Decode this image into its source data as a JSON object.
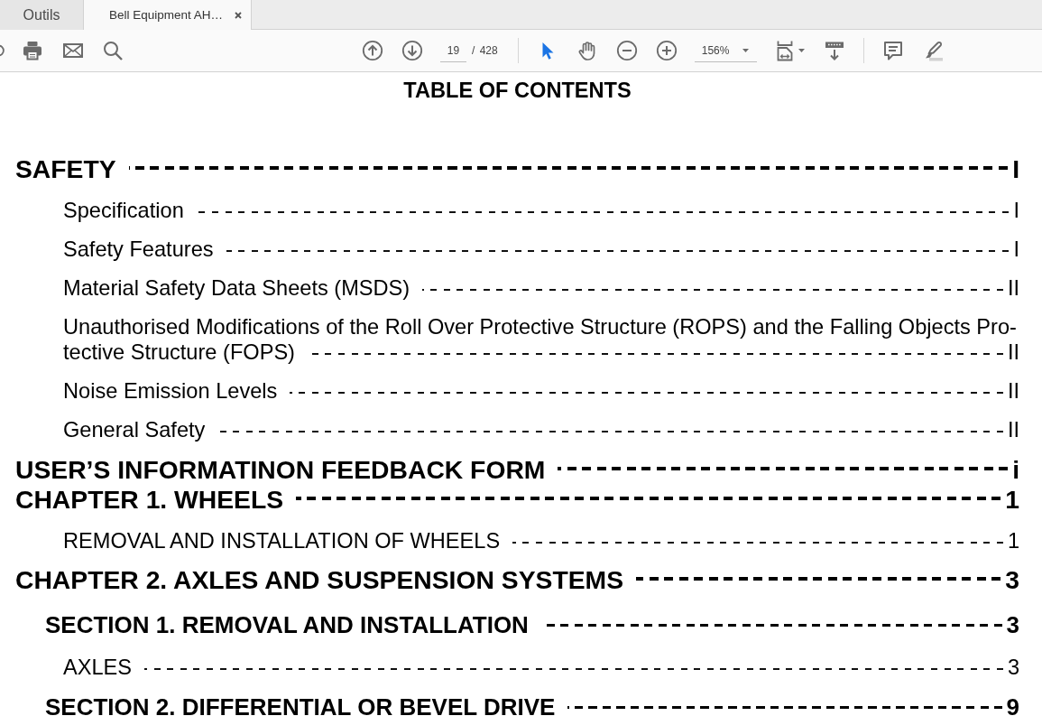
{
  "tabs": [
    {
      "label": "Outils",
      "kind": "tools",
      "selected": false
    },
    {
      "label": "Bell Equipment AH…",
      "kind": "document",
      "selected": true
    }
  ],
  "toolbar": {
    "page_field": {
      "value": "19"
    },
    "page_count": "/ 428",
    "tools": [
      {
        "kind": "select",
        "selected": true
      },
      {
        "kind": "hand",
        "selected": false
      }
    ],
    "zoom_field": {
      "value": "156%"
    }
  },
  "document": {
    "title": "TABLE OF CONTENTS",
    "entries": [
      {
        "kind": "chapter",
        "title": "SAFETY",
        "page": "I",
        "children": [
          {
            "kind": "entry",
            "title": "Specification",
            "page": "I"
          },
          {
            "kind": "entry",
            "title": "Safety Features",
            "page": "I"
          },
          {
            "kind": "entry",
            "title": "Material Safety Data Sheets (MSDS)",
            "page": "II"
          },
          {
            "kind": "entry",
            "lines": [
              "Unauthorised Modifications of the Roll Over Protective Structure (ROPS) and the Falling Objects Pro-",
              "tective Structure (FOPS)"
            ],
            "page": "II"
          },
          {
            "kind": "entry",
            "title": "Noise Emission Levels",
            "page": "II"
          },
          {
            "kind": "entry",
            "title": "General Safety",
            "page": "II"
          }
        ]
      },
      {
        "kind": "chapter",
        "title": "USER’S INFORMATINON FEEDBACK FORM",
        "page": "i"
      },
      {
        "kind": "chapter",
        "title": "CHAPTER 1. WHEELS",
        "page": "1",
        "children": [
          {
            "kind": "entry",
            "title": "REMOVAL AND INSTALLATION OF WHEELS",
            "page": "1"
          }
        ]
      },
      {
        "kind": "chapter",
        "title": "CHAPTER 2. AXLES AND SUSPENSION SYSTEMS",
        "page": "3",
        "children": [
          {
            "kind": "section",
            "title": "SECTION 1. REMOVAL AND INSTALLATION",
            "page": "3",
            "children": [
              {
                "kind": "entry",
                "title": "AXLES",
                "page": "3"
              }
            ]
          },
          {
            "kind": "section",
            "title": "SECTION 2. DIFFERENTIAL OR BEVEL DRIVE",
            "page": "9"
          }
        ]
      }
    ]
  }
}
